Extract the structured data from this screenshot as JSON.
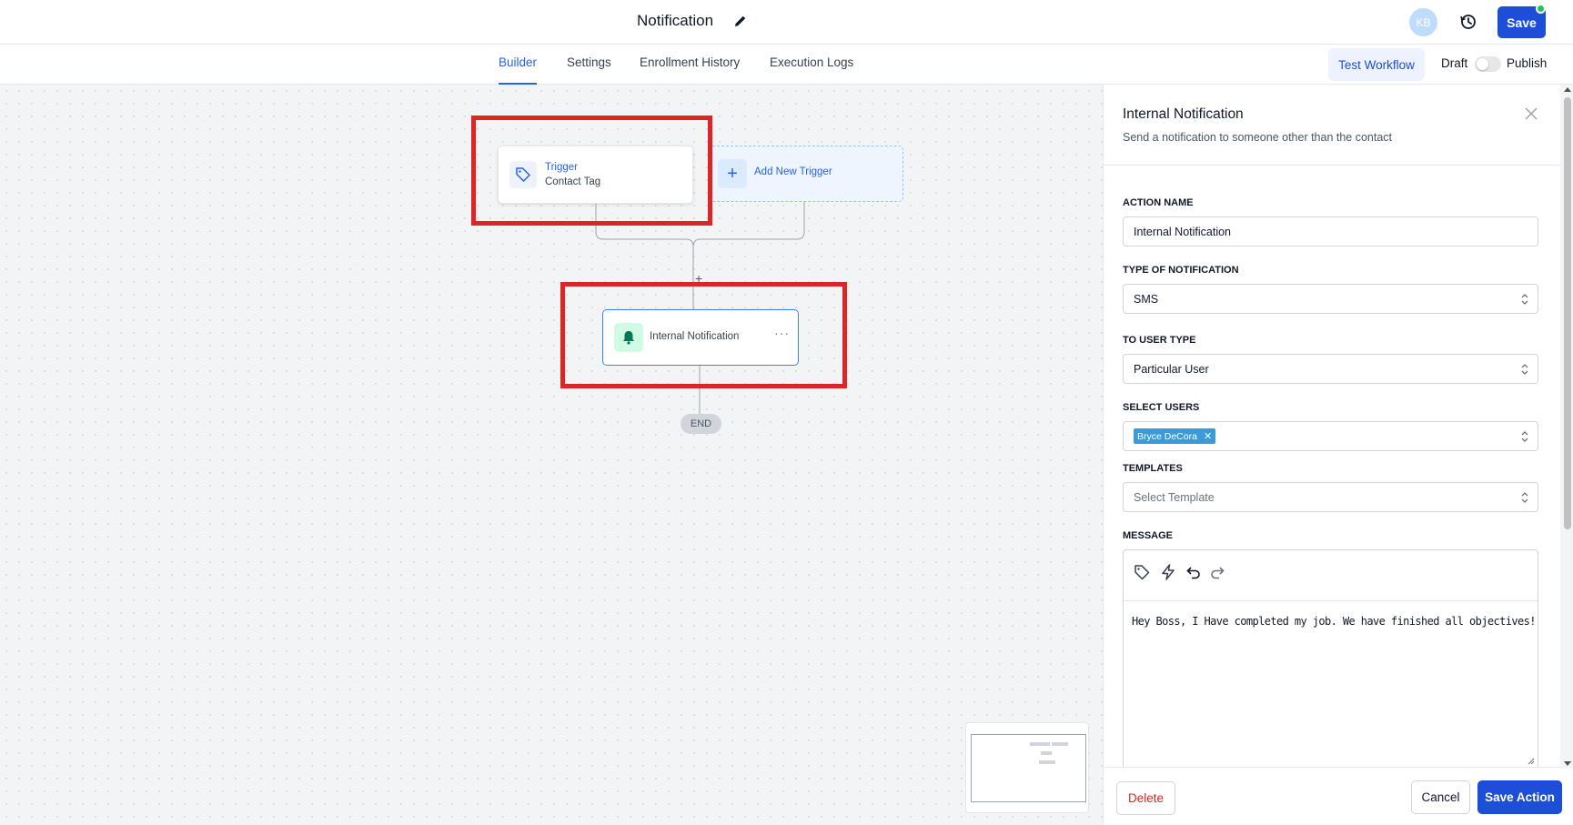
{
  "header": {
    "title": "Notification",
    "avatar_initials": "KB",
    "save_label": "Save"
  },
  "tabs": [
    {
      "label": "Builder",
      "active": true
    },
    {
      "label": "Settings",
      "active": false
    },
    {
      "label": "Enrollment History",
      "active": false
    },
    {
      "label": "Execution Logs",
      "active": false
    }
  ],
  "toolbar": {
    "test_workflow_label": "Test Workflow",
    "draft_label": "Draft",
    "publish_label": "Publish",
    "published": false
  },
  "canvas": {
    "trigger": {
      "title": "Trigger",
      "subtitle": "Contact Tag",
      "icon": "tag-icon"
    },
    "add_trigger_label": "Add New Trigger",
    "action": {
      "label": "Internal Notification",
      "icon": "bell-icon"
    },
    "end_label": "END",
    "plus_label": "+"
  },
  "panel": {
    "title": "Internal Notification",
    "subtitle": "Send a notification to someone other than the contact",
    "fields": {
      "action_name": {
        "label": "ACTION NAME",
        "value": "Internal Notification"
      },
      "type_of_notification": {
        "label": "TYPE OF NOTIFICATION",
        "value": "SMS"
      },
      "to_user_type": {
        "label": "TO USER TYPE",
        "value": "Particular User"
      },
      "select_users": {
        "label": "SELECT USERS",
        "chips": [
          "Bryce DeCora"
        ]
      },
      "templates": {
        "label": "TEMPLATES",
        "placeholder": "Select Template"
      },
      "message": {
        "label": "MESSAGE",
        "value": "Hey Boss, I Have completed my job. We have finished all objectives!"
      }
    },
    "footer": {
      "delete_label": "Delete",
      "cancel_label": "Cancel",
      "save_action_label": "Save Action"
    }
  },
  "colors": {
    "accent": "#1d4ed8",
    "highlight_box": "#dc2626",
    "status_dot": "#22c55e"
  }
}
